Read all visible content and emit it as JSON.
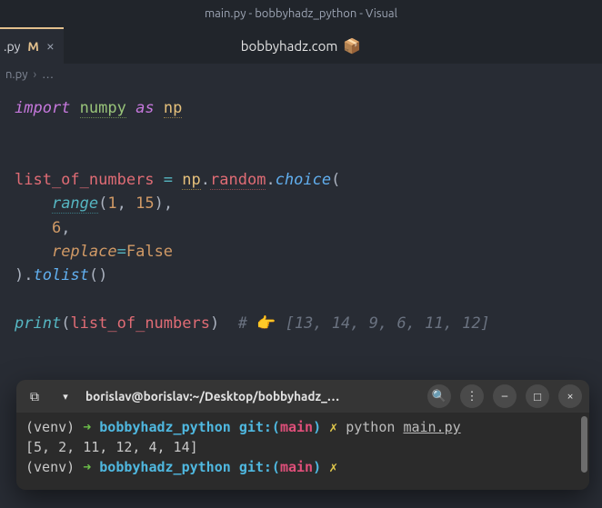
{
  "title_bar": "main.py - bobbyhadz_python - Visual",
  "tab": {
    "filename": ".py",
    "modified_marker": "M",
    "close_glyph": "×"
  },
  "center_overlay": {
    "text": "bobbyhadz.com",
    "icon": "📦"
  },
  "breadcrumbs": {
    "file": "n.py",
    "sep": "›",
    "rest": "…"
  },
  "code": {
    "import_kw": "import",
    "numpy": "numpy",
    "as_kw": "as",
    "np_alias": "np",
    "list_var": "list_of_numbers",
    "eq": "=",
    "np_ref": "np",
    "dot": ".",
    "random_attr": "random",
    "choice_fn": "choice",
    "open_p": "(",
    "range_fn": "range",
    "r_open": "(",
    "r_arg1": "1",
    "r_comma": ",",
    "r_space": " ",
    "r_arg2": "15",
    "r_close": ")",
    "comma1": ",",
    "arg_n": "6",
    "comma2": ",",
    "replace_kw": "replace",
    "assign_eq": "=",
    "false_val": "False",
    "close_p": ")",
    "tolist": "tolist",
    "empty_call": "()",
    "print_fn": "print",
    "p_open": "(",
    "p_arg": "list_of_numbers",
    "p_close": ")",
    "comment_hash": "#",
    "comment_emoji": "👉",
    "comment_list": "[13, 14, 9, 6, 11, 12]"
  },
  "terminal": {
    "title": "borislav@borislav:~/Desktop/bobbyhadz_…",
    "newtab_glyph": "⧉",
    "chev_glyph": "▾",
    "search_glyph": "🔍",
    "menu_glyph": "⋮",
    "min_glyph": "–",
    "max_glyph": "□",
    "close_glyph": "×",
    "line1": {
      "venv": "(venv)",
      "arrow": "➜",
      "cwd": "bobbyhadz_python",
      "git_label": "git:(",
      "branch": "main",
      "git_close": ")",
      "x": "✗",
      "cmd_python": "python",
      "cmd_file": "main.py"
    },
    "output": "[5, 2, 11, 12, 4, 14]",
    "line2": {
      "venv": "(venv)",
      "arrow": "➜",
      "cwd": "bobbyhadz_python",
      "git_label": "git:(",
      "branch": "main",
      "git_close": ")",
      "x": "✗"
    }
  }
}
